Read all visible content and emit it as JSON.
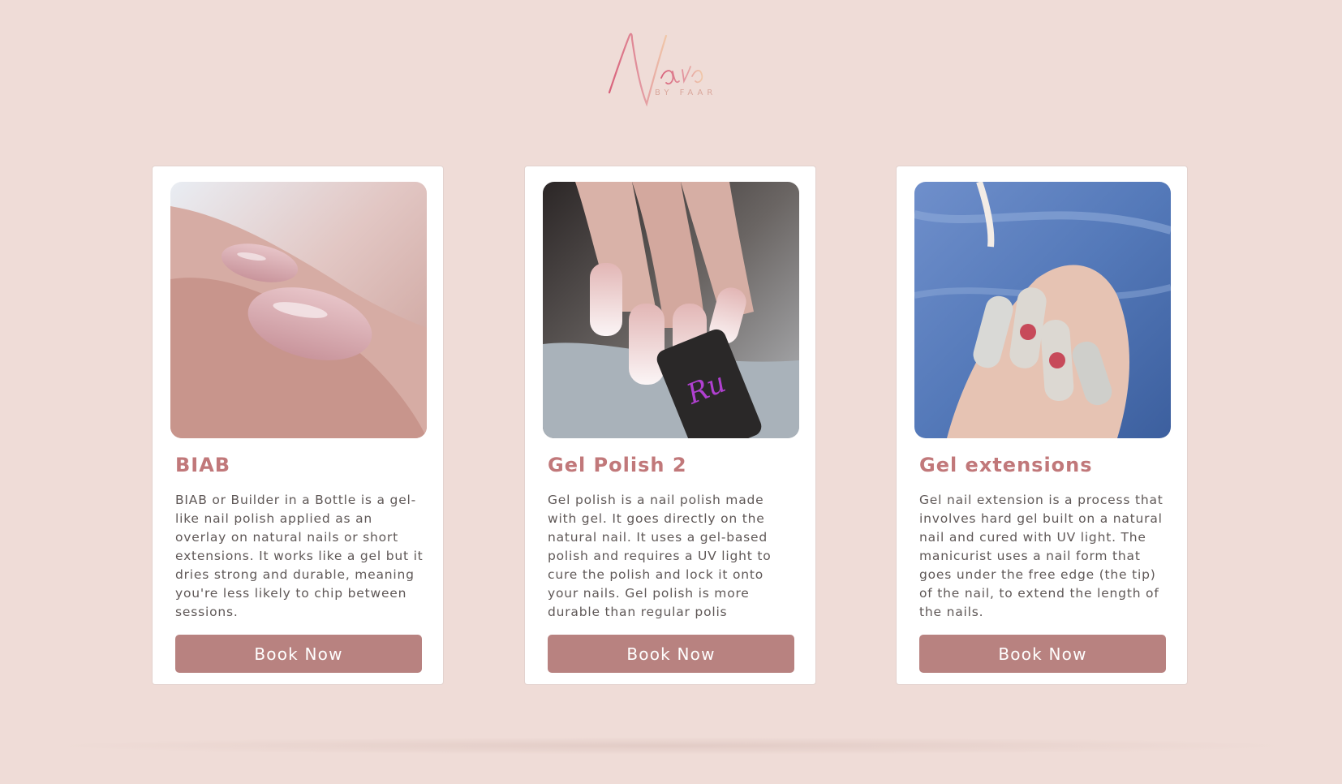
{
  "logo": {
    "script_text": "Nails",
    "sub_text": "BY FAAR"
  },
  "colors": {
    "background": "#efdcd7",
    "card": "#ffffff",
    "accent": "#c1787a",
    "button": "#b88280",
    "text": "#5f5857"
  },
  "cards": [
    {
      "title": "BIAB",
      "description": "BIAB or Builder in a Bottle is a gel-like nail polish applied as an overlay on natural nails or short extensions. It works like a gel but it dries strong and durable, meaning you're less likely to chip between sessions.",
      "button_label": "Book Now",
      "image_alt": "nude pink manicured nails"
    },
    {
      "title": "Gel Polish 2",
      "description": "Gel polish is a nail polish made with gel. It goes directly on the natural nail. It uses a gel-based polish and requires a UV light to cure the polish and lock it onto your nails. Gel polish is more durable than regular polis",
      "button_label": "Book Now",
      "image_alt": "ombre nails holding gel polish bottle"
    },
    {
      "title": "Gel extensions",
      "description": "Gel nail extension is a process that involves hard gel built on a natural nail and cured with UV light. The manicurist uses a nail form that goes under the free edge (the tip) of the nail, to extend the length of the nails.",
      "button_label": "Book Now",
      "image_alt": "long nails with art over denim"
    }
  ]
}
